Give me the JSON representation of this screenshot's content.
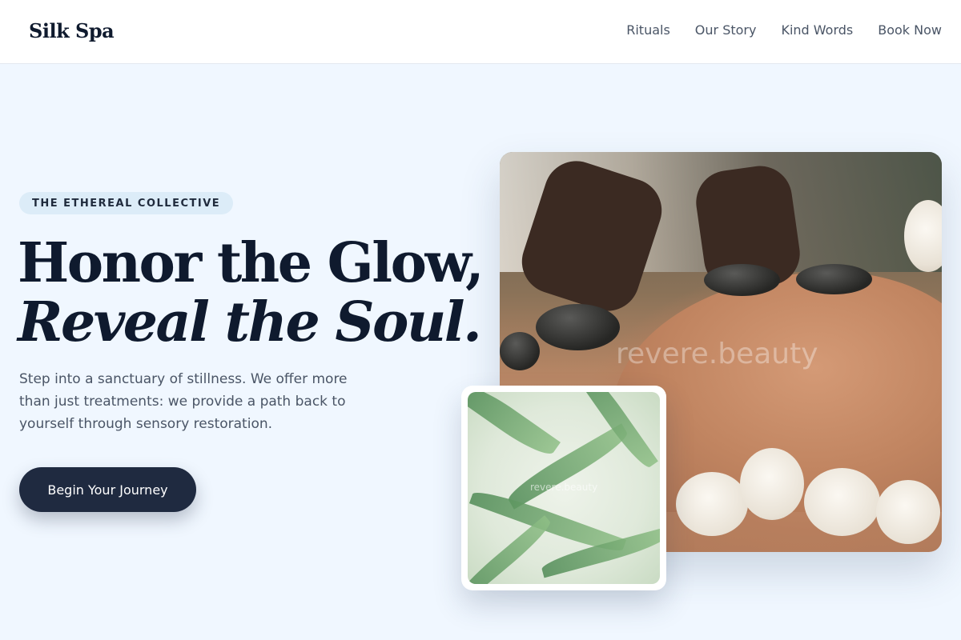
{
  "header": {
    "brand": "Silk Spa",
    "nav": [
      "Rituals",
      "Our Story",
      "Kind Words",
      "Book Now"
    ]
  },
  "hero": {
    "eyebrow": "THE ETHEREAL COLLECTIVE",
    "headline_line1": "Honor the Glow,",
    "headline_line2": "Reveal the Soul.",
    "lede": "Step into a sanctuary of stillness. We offer more than just treatments: we provide a path back to yourself through sensory restoration.",
    "cta_label": "Begin Your Journey"
  },
  "images": {
    "main_watermark": "revere.beauty",
    "secondary_watermark": "revere.beauty"
  },
  "colors": {
    "background": "#f0f7ff",
    "ink": "#0f1a2e",
    "cta": "#1f2a40",
    "eyebrow_bg": "#dcecf8"
  }
}
